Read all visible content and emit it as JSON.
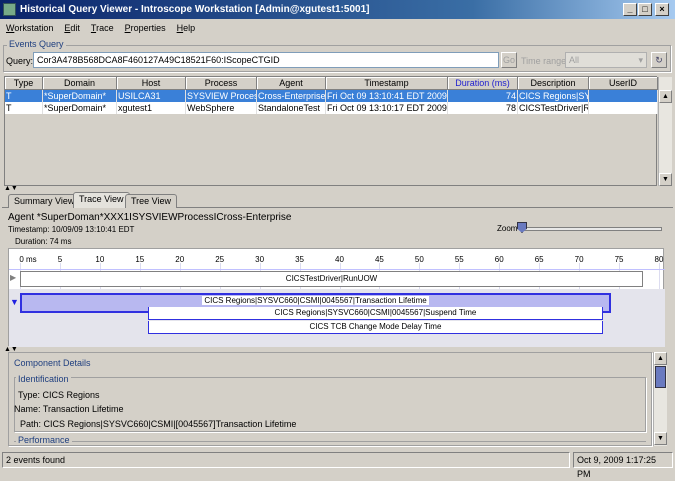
{
  "window": {
    "title": "Historical Query Viewer - Introscope Workstation [Admin@xgutest1:5001]",
    "controls": [
      "minimize-icon",
      "maximize-icon",
      "close-icon"
    ]
  },
  "menu": [
    "Workstation",
    "Edit",
    "Trace",
    "Properties",
    "Help"
  ],
  "query": {
    "group_title": "Events Query",
    "label": "Query:",
    "value": "Cor3A478B568DCA8F460127A49C18521F60:IScopeCTGID",
    "go": "Go",
    "time_range_label": "Time range:",
    "time_range_value": "All"
  },
  "table": {
    "columns": [
      "Type",
      "Domain",
      "Host",
      "Process",
      "Agent",
      "Timestamp",
      "Duration (ms)",
      "Description",
      "UserID"
    ],
    "sorted_column": "Duration (ms)",
    "rows": [
      {
        "selected": true,
        "cells": [
          "T",
          "*SuperDomain*",
          "USILCA31",
          "SYSVIEW Process",
          "Cross-Enterprise",
          "Fri Oct 09 13:10:41 EDT 2009",
          "74",
          "CICS Regions|SY...",
          ""
        ]
      },
      {
        "selected": false,
        "cells": [
          "T",
          "*SuperDomain*",
          "xgutest1",
          "WebSphere",
          "StandaloneTest",
          "Fri Oct 09 13:10:17 EDT 2009",
          "78",
          "CICSTestDriver|R...",
          ""
        ]
      }
    ]
  },
  "tabs": [
    {
      "label": "Summary View"
    },
    {
      "label": "Trace View",
      "active": true
    },
    {
      "label": "Tree View"
    }
  ],
  "trace": {
    "agent": "Agent *SuperDoman*XXX1ISYSVIEWProcessICross-Enterprise",
    "timestamp": "Timestamp: 10/09/09 13:10:41 EDT",
    "duration": "Duration: 74 ms",
    "zoom_label": "Zoom",
    "zoom_level": 0,
    "axis": {
      "unit": "ms",
      "min": 0,
      "max": 80,
      "ticks": [
        "0 ms",
        "5",
        "10",
        "15",
        "20",
        "25",
        "30",
        "35",
        "40",
        "45",
        "50",
        "55",
        "60",
        "65",
        "70",
        "75",
        "80"
      ]
    },
    "components": [
      {
        "label": "CICSTestDriver|RunUOW",
        "start": 0,
        "end": 78,
        "row": 0,
        "group": 1
      },
      {
        "label": "CICS Regions|SYSVC660|CSMI|0045567|Transaction Lifetime",
        "start": 0,
        "end": 74,
        "row": 0,
        "group": 2,
        "selected": true
      },
      {
        "label": "CICS Regions|SYSVC660|CSMI|0045567|Suspend Time",
        "start": 16,
        "end": 73,
        "row": 1,
        "group": 2
      },
      {
        "label": "CICS TCB Change Mode Delay Time",
        "start": 16,
        "end": 73,
        "row": 2,
        "group": 2
      }
    ]
  },
  "details": {
    "title": "Component Details",
    "identification_title": "Identification",
    "type_label": "Type:",
    "type": "CICS Regions",
    "name_label": "Name:",
    "name": "Transaction Lifetime",
    "path_label": "Path:",
    "path": "CICS Regions|SYSVC660|CSMI|[0045567]Transaction Lifetime",
    "performance_title": "Performance"
  },
  "status": {
    "left": "2 events found",
    "right": "Oct 9, 2009 1:17:25 PM"
  },
  "colors": {
    "title_bar": "#0a246a",
    "selection": "#3a80d8",
    "trace_outline": "#3030e0",
    "sorted_header": "#2020d0"
  }
}
